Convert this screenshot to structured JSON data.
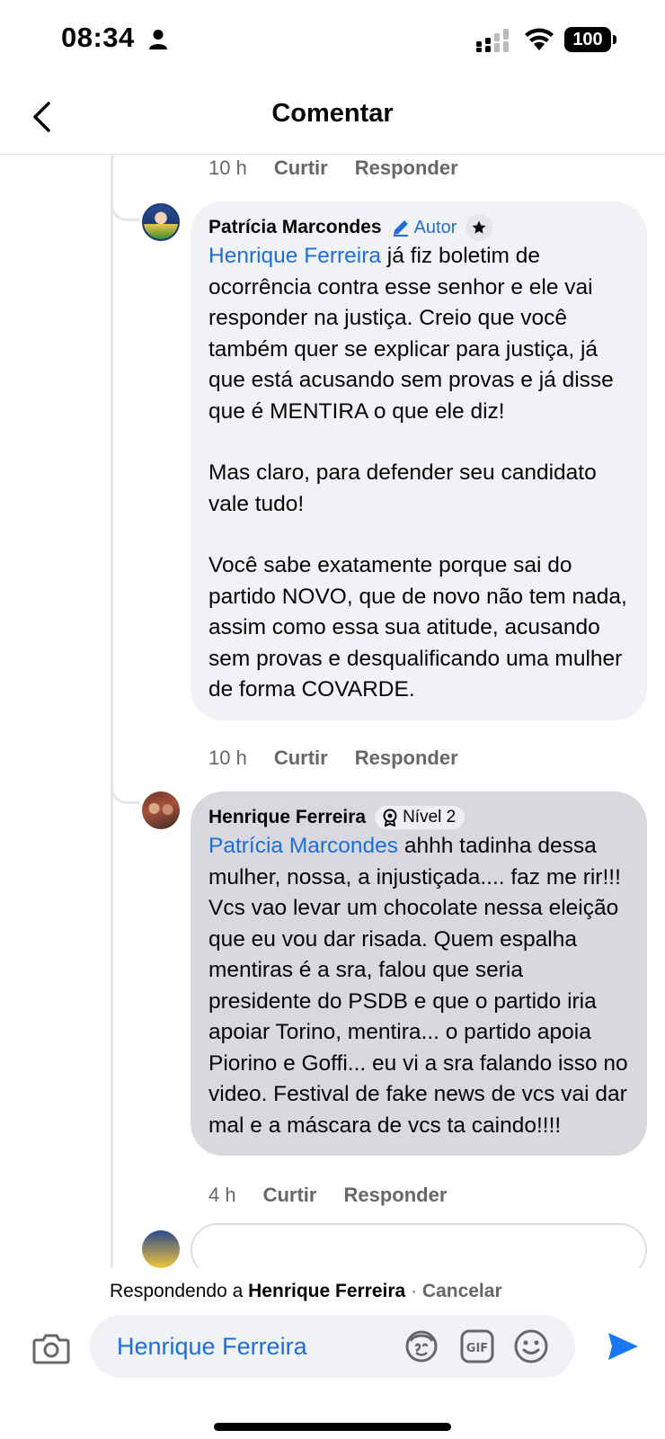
{
  "status_bar": {
    "time": "08:34",
    "battery": "100"
  },
  "header": {
    "title": "Comentar"
  },
  "thread": {
    "previous_meta": {
      "time": "10 h",
      "like": "Curtir",
      "reply": "Responder"
    },
    "comments": [
      {
        "author": "Patrícia Marcondes",
        "badge": "Autor",
        "mention": "Henrique Ferreira",
        "paragraphs": [
          " já fiz boletim de ocorrência contra esse senhor e ele vai responder na justiça. Creio que você também quer se explicar para justiça, já que está acusando sem provas e já disse que é MENTIRA o que ele diz!",
          "Mas claro, para defender seu candidato vale tudo!",
          "Você sabe exatamente porque sai do partido NOVO, que de novo não tem nada, assim como essa sua atitude, acusando sem provas e desqualificando uma mulher de forma COVARDE."
        ],
        "time": "10 h",
        "like": "Curtir",
        "reply": "Responder"
      },
      {
        "author": "Henrique Ferreira",
        "badge": "Nível 2",
        "mention": "Patrícia Marcondes",
        "paragraphs": [
          " ahhh tadinha dessa mulher, nossa, a injustiçada.... faz me rir!!! Vcs vao levar um chocolate nessa eleição que eu vou dar risada. Quem espalha mentiras é a sra, falou que seria presidente do PSDB e que o partido iria apoiar Torino, mentira... o partido apoia Piorino e Goffi... eu vi a sra falando isso no video. Festival de fake news de vcs vai dar mal e a máscara de vcs ta caindo!!!!"
        ],
        "time": "4 h",
        "like": "Curtir",
        "reply": "Responder"
      }
    ]
  },
  "reply_bar": {
    "prefix": "Respondendo a",
    "name": "Henrique Ferreira",
    "separator": "·",
    "cancel": "Cancelar",
    "input_value": "Henrique Ferreira"
  },
  "icons": {
    "camera": "camera-icon",
    "avatar_sticker": "avatar-sticker-icon",
    "gif": "gif-icon",
    "emoji": "emoji-icon",
    "send": "send-icon"
  },
  "colors": {
    "link": "#1d6ed8",
    "send": "#1877f2",
    "bubble": "#f0f2f5",
    "bubble_selected": "#d7d9de"
  }
}
